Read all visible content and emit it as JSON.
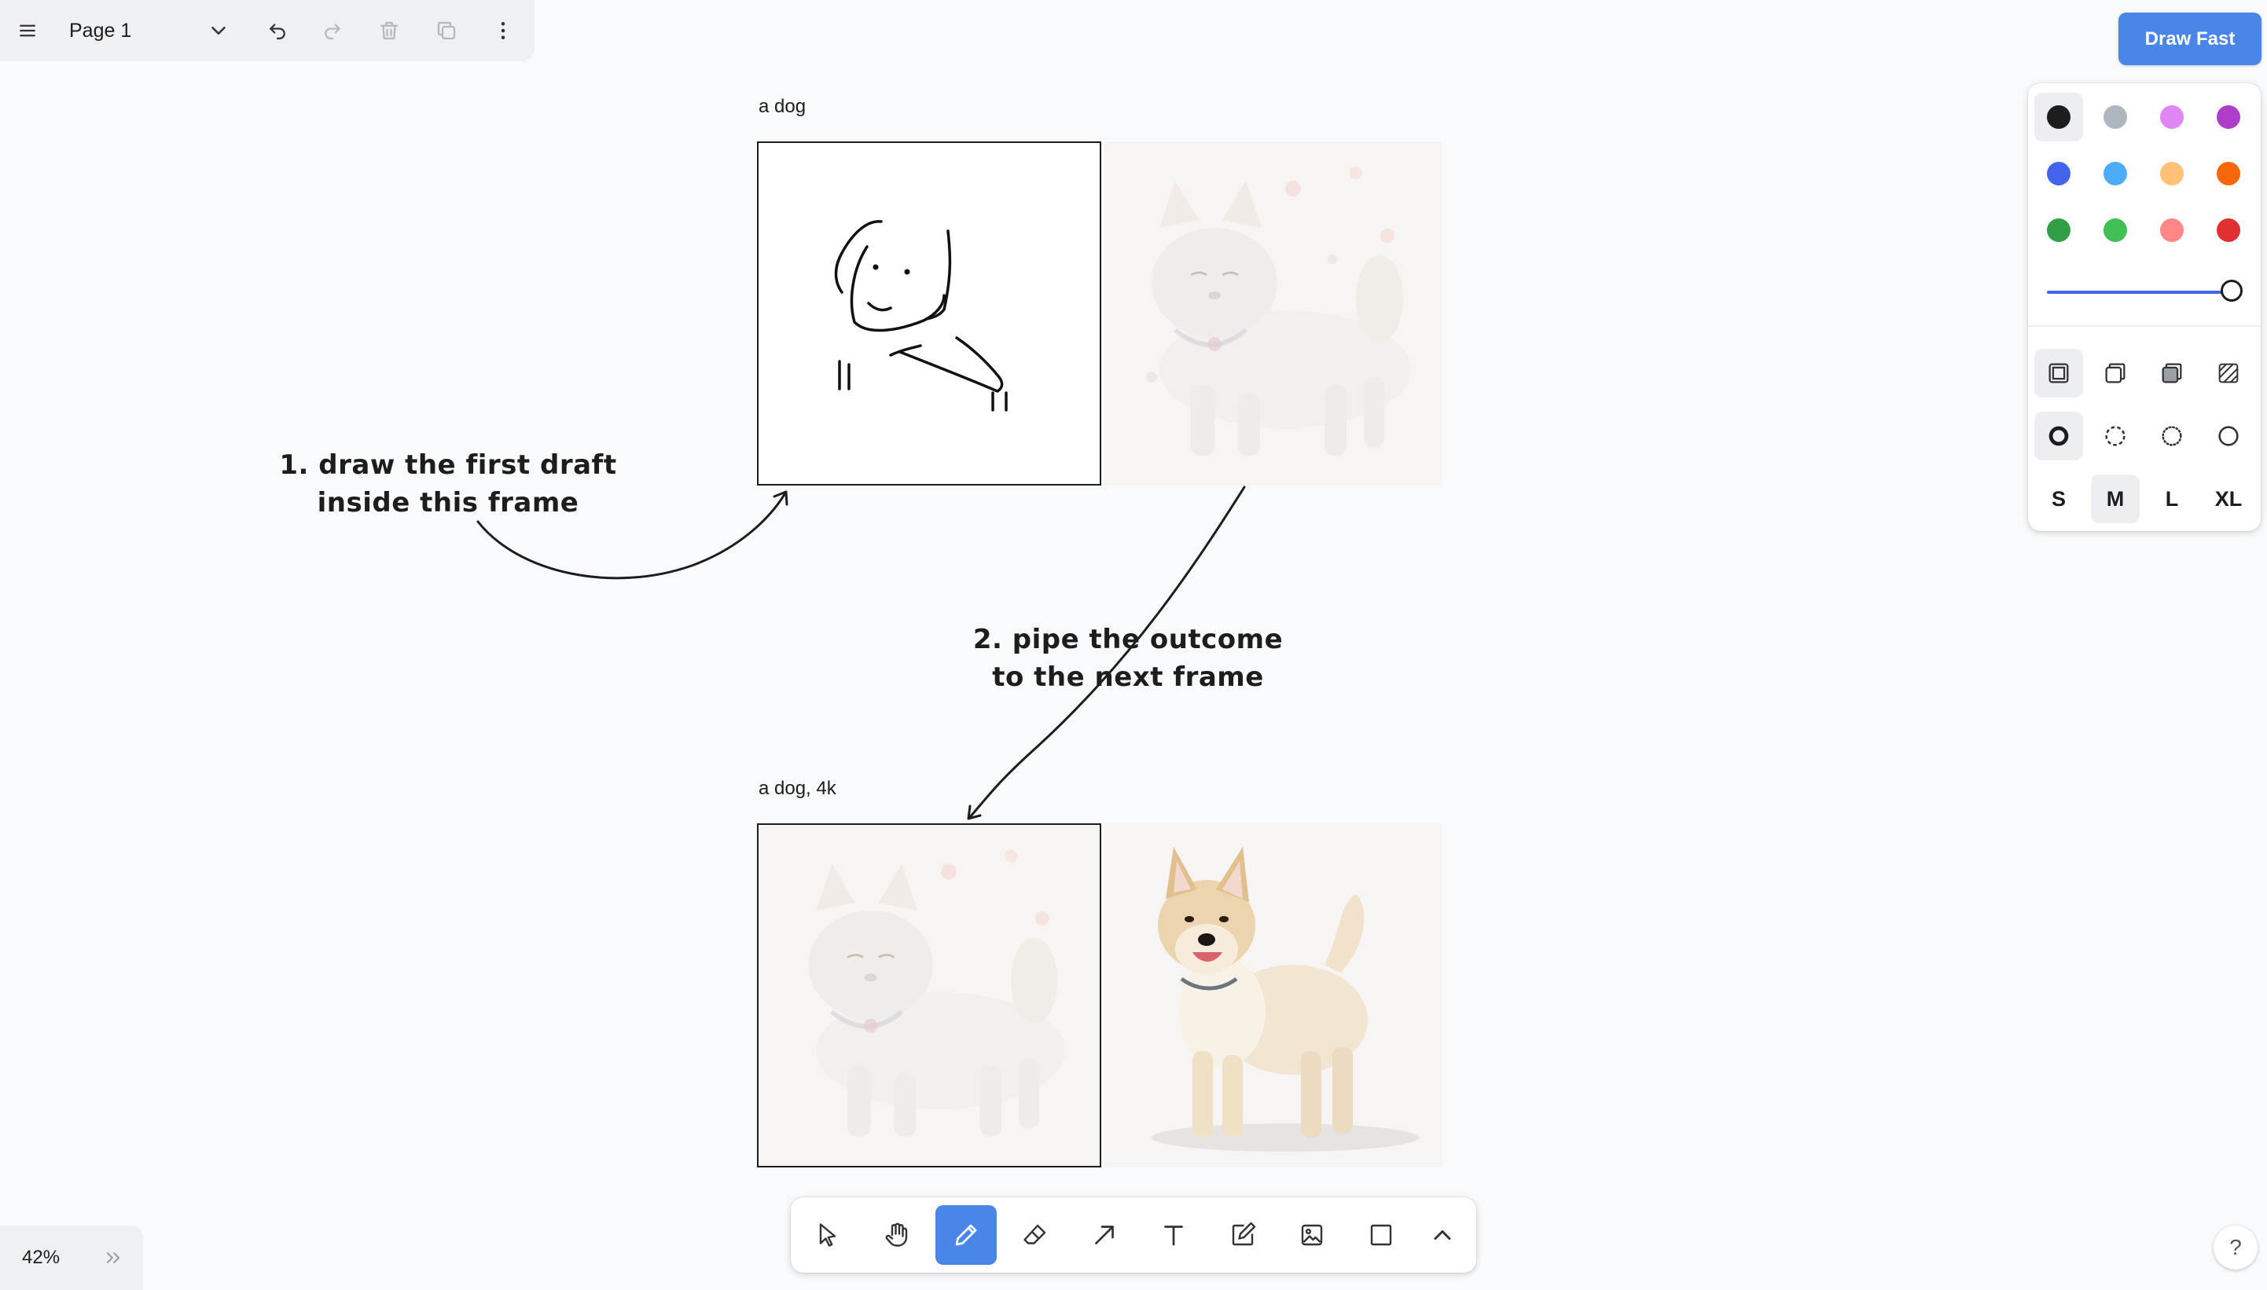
{
  "topbar": {
    "page_name": "Page 1",
    "icons": [
      "menu-icon",
      "chevron-down-icon",
      "undo-icon",
      "redo-icon",
      "trash-icon",
      "duplicate-icon",
      "more-icon"
    ]
  },
  "draw_fast": {
    "label": "Draw Fast"
  },
  "style_panel": {
    "colors": [
      "#1d1d1d",
      "#adb5bd",
      "#e085f4",
      "#ae3ec9",
      "#4263eb",
      "#4dabf7",
      "#ffc078",
      "#f76707",
      "#2f9e44",
      "#40c057",
      "#ff8787",
      "#e03131"
    ],
    "selected_color": "#1d1d1d",
    "opacity": 1.0,
    "fill_options": [
      "fill-none-icon",
      "fill-semi-icon",
      "fill-solid-icon",
      "fill-pattern-icon"
    ],
    "dash_options": [
      "dash-draw-icon",
      "dash-dashed-icon",
      "dash-dotted-icon",
      "dash-solid-icon"
    ],
    "sizes": [
      "S",
      "M",
      "L",
      "XL"
    ],
    "selected_size": "M"
  },
  "canvas": {
    "frame1_label": "a dog",
    "frame2_label": "a dog, 4k",
    "note1": [
      "1. draw the first draft",
      "inside this frame"
    ],
    "note2": [
      "2. pipe the outcome",
      "to the next frame"
    ]
  },
  "toolbar": {
    "tools": [
      "select-icon",
      "hand-icon",
      "draw-icon",
      "eraser-icon",
      "arrow-icon",
      "text-icon",
      "note-icon",
      "image-icon",
      "rectangle-icon",
      "chevron-up-icon"
    ],
    "active_tool": "draw-icon"
  },
  "zoom": {
    "level": "42%"
  },
  "colors": {
    "accent": "#4a86e8",
    "background": "#f9fafb"
  }
}
